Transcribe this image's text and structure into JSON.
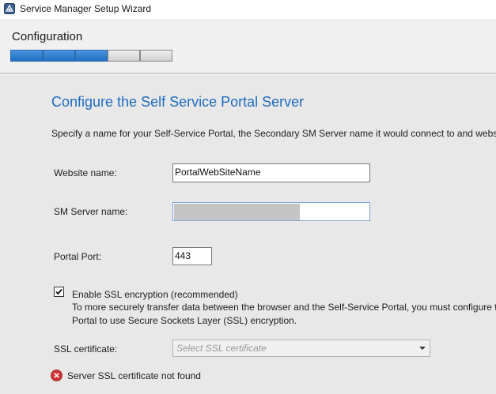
{
  "window": {
    "title": "Service Manager Setup Wizard"
  },
  "header": {
    "title": "Configuration",
    "progress": {
      "completed_steps": 3,
      "total_steps": 5
    }
  },
  "main": {
    "page_title": "Configure the Self Service Portal Server",
    "description": "Specify a name for your Self-Service Portal, the Secondary SM Server name it would connect to and websit",
    "website_name": {
      "label": "Website name:",
      "value": "PortalWebSiteName"
    },
    "sm_server_name": {
      "label": "SM Server name:",
      "value": ""
    },
    "portal_port": {
      "label": "Portal Port:",
      "value": "443"
    },
    "ssl": {
      "checked": true,
      "label": "Enable SSL encryption (recommended)",
      "help_line1": "To more securely transfer data between the browser and the Self-Service Portal, you must configure th",
      "help_line2": "Portal to use Secure Sockets Layer (SSL) encryption."
    },
    "ssl_certificate": {
      "label": "SSL certificate:",
      "placeholder": "Select SSL certificate"
    },
    "error": {
      "message": "Server SSL certificate not found",
      "icon": "error-icon"
    }
  },
  "colors": {
    "accent": "#1f6bbf",
    "progress_fill": "#2a7bd0",
    "error": "#d13438"
  }
}
